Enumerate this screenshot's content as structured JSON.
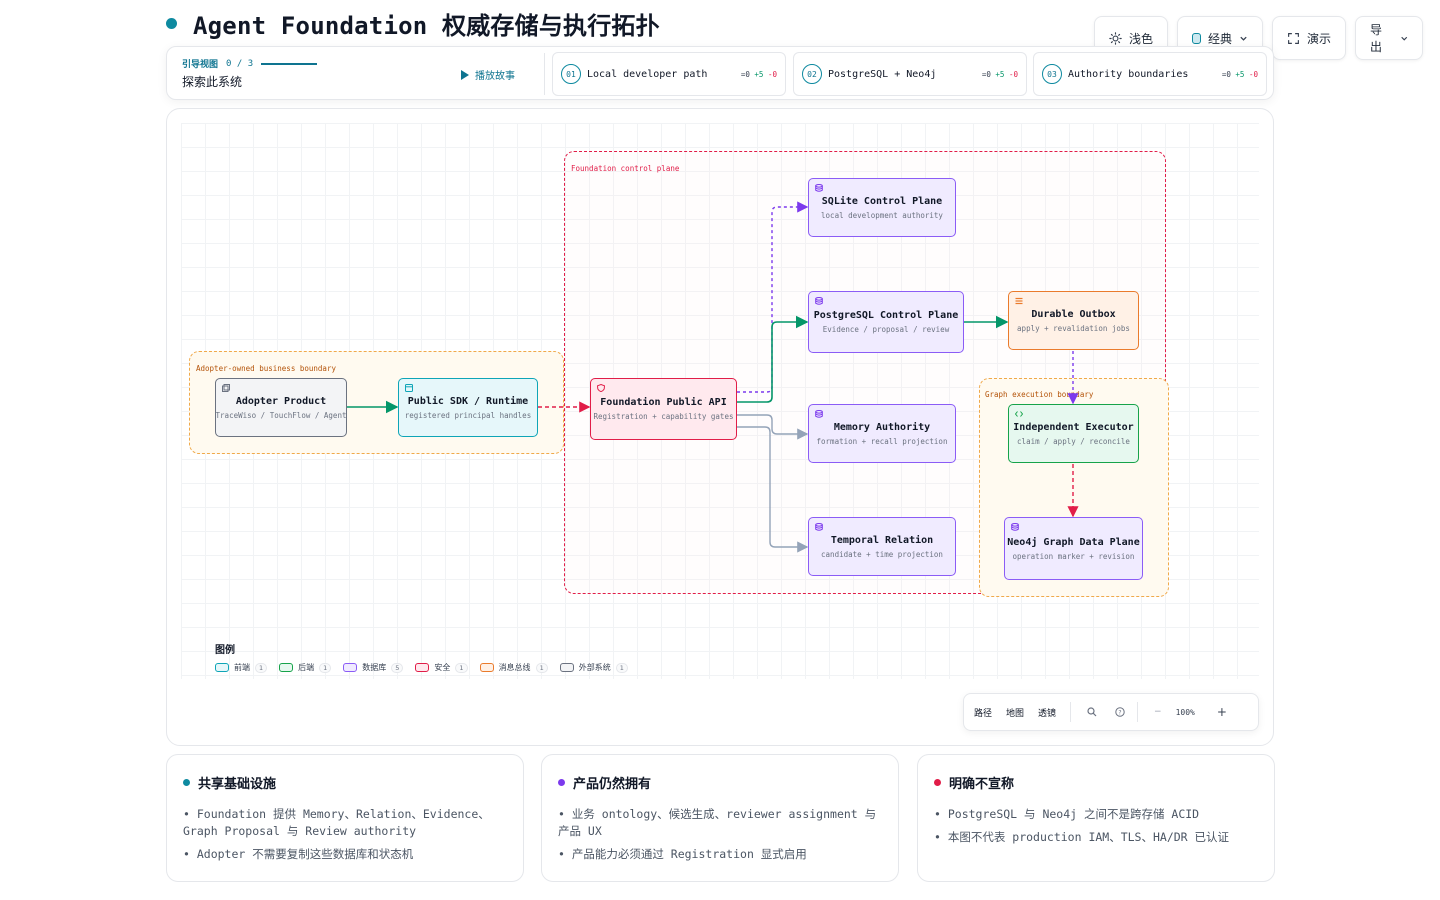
{
  "title": "Agent Foundation 权威存储与执行拓扑",
  "toolbar": {
    "theme_label": "浅色",
    "style_label": "经典",
    "present_label": "演示",
    "export_label": "导出"
  },
  "story": {
    "guide_label": "引导视图",
    "progress": "0 / 3",
    "subtitle": "探索此系统",
    "play_label": "播放故事",
    "steps": [
      {
        "num": "01",
        "label": "Local developer path",
        "eq": "=0",
        "plus": "+5",
        "minus": "-0"
      },
      {
        "num": "02",
        "label": "PostgreSQL + Neo4j",
        "eq": "=0",
        "plus": "+5",
        "minus": "-0"
      },
      {
        "num": "03",
        "label": "Authority boundaries",
        "eq": "=0",
        "plus": "+5",
        "minus": "-0"
      }
    ]
  },
  "boundaries": {
    "control_plane": "Foundation control plane",
    "adopter": "Adopter-owned business boundary",
    "graph": "Graph execution boundary"
  },
  "nodes": {
    "adopter": {
      "title": "Adopter Product",
      "sub": "TraceWiso / TouchFlow / Agent"
    },
    "sdk": {
      "title": "Public SDK / Runtime",
      "sub": "registered principal handles"
    },
    "api": {
      "title": "Foundation Public API",
      "sub": "Registration + capability gates"
    },
    "sqlite": {
      "title": "SQLite Control Plane",
      "sub": "local development authority"
    },
    "postgres": {
      "title": "PostgreSQL Control Plane",
      "sub": "Evidence / proposal / review"
    },
    "outbox": {
      "title": "Durable Outbox",
      "sub": "apply + revalidation jobs"
    },
    "memory": {
      "title": "Memory Authority",
      "sub": "formation + recall projection"
    },
    "executor": {
      "title": "Independent Executor",
      "sub": "claim / apply / reconcile"
    },
    "temporal": {
      "title": "Temporal Relation",
      "sub": "candidate + time projection"
    },
    "neo4j": {
      "title": "Neo4j Graph Data Plane",
      "sub": "operation marker + revision"
    }
  },
  "legend": {
    "title": "图例",
    "items": [
      {
        "label": "前端",
        "count": "1",
        "color": "#0ea5b7",
        "fill": "#e6f7fa"
      },
      {
        "label": "后端",
        "count": "1",
        "color": "#16a34a",
        "fill": "#e6f8ef"
      },
      {
        "label": "数据库",
        "count": "5",
        "color": "#8b5cf6",
        "fill": "#f0ebff"
      },
      {
        "label": "安全",
        "count": "1",
        "color": "#e11d48",
        "fill": "#ffe9ee"
      },
      {
        "label": "消息总线",
        "count": "1",
        "color": "#ea7b2c",
        "fill": "#fff1e6"
      },
      {
        "label": "外部系统",
        "count": "1",
        "color": "#6b7280",
        "fill": "#f3f4f6"
      }
    ]
  },
  "controls": {
    "path": "路径",
    "map": "地图",
    "lens": "透镜",
    "zoom": "100%",
    "minus": "−",
    "plus": "+"
  },
  "cards": [
    {
      "title": "共享基础设施",
      "color": "#0e8aa0",
      "items": [
        "Foundation 提供 Memory、Relation、Evidence、Graph Proposal 与 Review authority",
        "Adopter 不需要复制这些数据库和状态机"
      ]
    },
    {
      "title": "产品仍然拥有",
      "color": "#7c3aed",
      "items": [
        "业务 ontology、候选生成、reviewer assignment 与产品 UX",
        "产品能力必须通过 Registration 显式启用"
      ]
    },
    {
      "title": "明确不宣称",
      "color": "#e11d48",
      "items": [
        "PostgreSQL 与 Neo4j 之间不是跨存储 ACID",
        "本图不代表 production IAM、TLS、HA/DR 已认证"
      ]
    }
  ]
}
